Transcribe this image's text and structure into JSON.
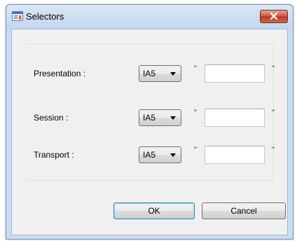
{
  "window": {
    "title": "Selectors"
  },
  "rows": [
    {
      "label": "Presentation :",
      "encoding": "IA5",
      "quote_open": "\"",
      "value": "",
      "quote_close": "\""
    },
    {
      "label": "Session :",
      "encoding": "IA5",
      "quote_open": "\"",
      "value": "",
      "quote_close": "\""
    },
    {
      "label": "Transport :",
      "encoding": "IA5",
      "quote_open": "\"",
      "value": "",
      "quote_close": "\""
    }
  ],
  "buttons": {
    "ok": "OK",
    "cancel": "Cancel"
  },
  "icons": {
    "title": "dialog-list-icon",
    "close": "close-icon",
    "dropdown": "chevron-down-icon"
  },
  "colors": {
    "titlebar": "#c9dcf1",
    "close_button": "#c6553f",
    "client_background": "#f0f0f0"
  }
}
